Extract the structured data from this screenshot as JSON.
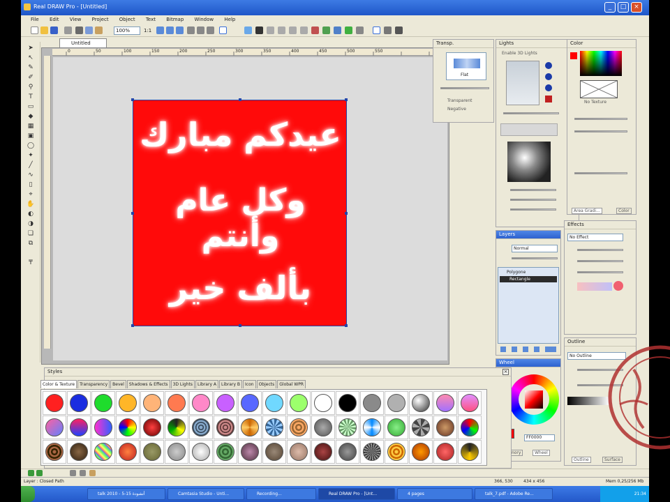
{
  "window": {
    "title": "Real DRAW Pro - [Untitled]"
  },
  "menu": [
    "File",
    "Edit",
    "View",
    "Project",
    "Object",
    "Text",
    "Bitmap",
    "Window",
    "Help"
  ],
  "toolbar": {
    "zoom": "100%",
    "ratio": "1:1"
  },
  "document": {
    "tab": "Untitled"
  },
  "canvas": {
    "background_color": "#ff0a0a",
    "text_lines": [
      "عيدكم مبارك",
      "وكل عام وأنتم",
      "بألف خير"
    ],
    "ruler_labels": [
      "0",
      "50",
      "100",
      "150",
      "200",
      "250",
      "300",
      "350",
      "400",
      "450",
      "500",
      "550"
    ]
  },
  "panels": {
    "transp": {
      "title": "Transp.",
      "preset": "Flat",
      "options": [
        "Transparent",
        "Negative"
      ]
    },
    "lights": {
      "title": "Lights",
      "enable": "Enable 3D Lights"
    },
    "color": {
      "title": "Color",
      "texture": "No Texture",
      "tabs": [
        "Area Gradi...",
        "Color"
      ]
    },
    "layers": {
      "title": "Layers",
      "mode": "Normal",
      "items": [
        "Polygone",
        "Rectangle"
      ]
    },
    "effects": {
      "title": "Effects",
      "value": "No Effect"
    },
    "wheel": {
      "title": "Wheel",
      "hex": "FF0000",
      "tabs": [
        "Memory",
        "Wheel"
      ]
    },
    "outline": {
      "title": "Outline",
      "value": "No Outline",
      "tabs": [
        "Outline",
        "Surface"
      ]
    }
  },
  "styles": {
    "title": "Styles",
    "tabs": [
      "Color & Texture",
      "Transparency",
      "Bevel",
      "Shadows & Effects",
      "3D Lights",
      "Library A",
      "Library B",
      "Icon",
      "Objects",
      "Global WPR"
    ],
    "row1_colors": [
      "#ff2020",
      "#1a2de0",
      "#1edc2c",
      "#ffb628",
      "#ffb478",
      "#ff7a50",
      "#ff88c8",
      "#c860ff",
      "#5868ff",
      "#70d8ff",
      "#9cff6c",
      "#ffffff",
      "#000000",
      "#8a8a8a",
      "#b0b0b0",
      "#5a5a5a",
      "#ff8ab0",
      "#e090ff"
    ]
  },
  "status": {
    "text": "Layer : Closed Path",
    "coords": "366, 530",
    "size": "434 x 456",
    "memory": "Mem 0,25/256 Mb"
  },
  "taskbar": {
    "items": [
      "talk 2010 - 5-15 أنشودة",
      "Camtasia Studio - Unti...",
      "Recording...",
      "Real DRAW Pro - [Unt...",
      "4 pages",
      "talk_7.pdf - Adobe Re..."
    ],
    "clock": "21:34"
  }
}
